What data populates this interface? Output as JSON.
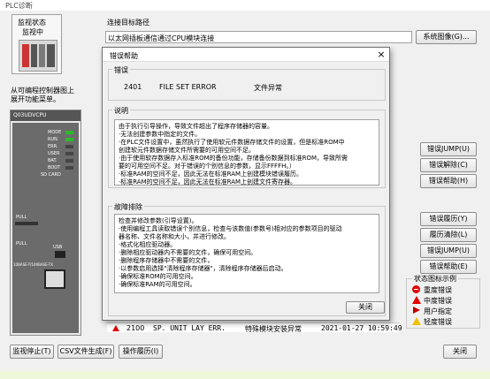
{
  "window": {
    "title": "PLC诊断"
  },
  "monitor": {
    "status_label": "监视状态",
    "status_value": "监视中"
  },
  "connection": {
    "label": "连接目标路径",
    "value": "以太网插板通信通过CPU模块连接",
    "system_image_button": "系统图像(G)..."
  },
  "left_hint": "从可编程控制器图上展开功能菜单。",
  "cpu": {
    "model": "Q03UDVCPU",
    "leds": [
      "MODE",
      "RUN",
      "ERR.",
      "USER",
      "BAT.",
      "BOOT",
      "SD CARD"
    ],
    "pull_label": "PULL",
    "usb_label": "USB",
    "ethernet_label": "10BASE-T/100BASE-TX"
  },
  "right_buttons": {
    "error_jump": "错误JUMP(U)",
    "error_clear": "错误解除(C)",
    "error_help": "错误帮助(H)",
    "error_history": "错误履历(Y)",
    "history_clear": "履历清除(L)",
    "error_jump2": "错误JUMP(U)",
    "error_help2": "错误帮助(E)"
  },
  "legend": {
    "title": "状态图标示例",
    "items": [
      {
        "label": "重度错误",
        "icon": "stop-icon",
        "color": "#e00000"
      },
      {
        "label": "中度错误",
        "icon": "warning-triangle-icon",
        "color": "#e00000"
      },
      {
        "label": "用户指定",
        "icon": "arrow-right-icon",
        "color": "#c00000"
      },
      {
        "label": "轻度错误",
        "icon": "warning-triangle-icon",
        "color": "#f0c000"
      }
    ]
  },
  "bottom_row": {
    "code": "2100",
    "name": "SP. UNIT LAY ERR.",
    "detail": "特殊模块安装异常",
    "time": "2021-01-27 10:59:49"
  },
  "bottom_buttons": {
    "stop_monitor": "监视停止(T)",
    "csv": "CSV文件生成(F)",
    "operation_history": "操作履历(I)",
    "close": "关闭"
  },
  "dialog": {
    "title": "错误帮助",
    "error_section": {
      "label": "错误",
      "code": "2401",
      "name": "FILE SET ERROR",
      "description": "文件异常"
    },
    "explain_section": {
      "label": "说明",
      "lines": [
        "由于执行引导操作，导致文件超出了程序存储器的容量。",
        "·无法创建参数中指定的文件。",
        "·在PLC文件设置中，虽然执行了使用软元件数据存储文件的设置，但是标准ROM中",
        "  创建软元件数据存储文件所需要的可用空间不足。",
        "·由于使用软存数据存入标准ROM的备份功能，存储备份数据到标准ROM，导致所需",
        "  要的可用空间不足。对于错误的个别信息的参数，显示FFFFH。）",
        "·标准RAM的空间不足，因此无法在标准RAM上创建模块错误履历。",
        "·标准RAM的空间不足，因此无法在标准RAM上创建文件寄存器。"
      ]
    },
    "trouble_section": {
      "label": "故障排除",
      "lines": [
        "检查并修改参数(引导设置)。",
        "·使用编程工具读取错误个别信息，检查与该数值(参数号)相对应的参数项目的驱动",
        "  器名称、文件名称和大小，并进行修改。",
        "·格式化相应驱动器。",
        "·删除相应驱动器内不需要的文件，确保可用空间。",
        "·删除程序存储器中不需要的文件，",
        "·以参数启用选择\"清除程序存储器\"，清除程序存储器后启动。",
        "·确保标准ROM的可用空间。",
        "·确保标准RAM的可用空间。"
      ]
    },
    "close_button": "关闭"
  }
}
